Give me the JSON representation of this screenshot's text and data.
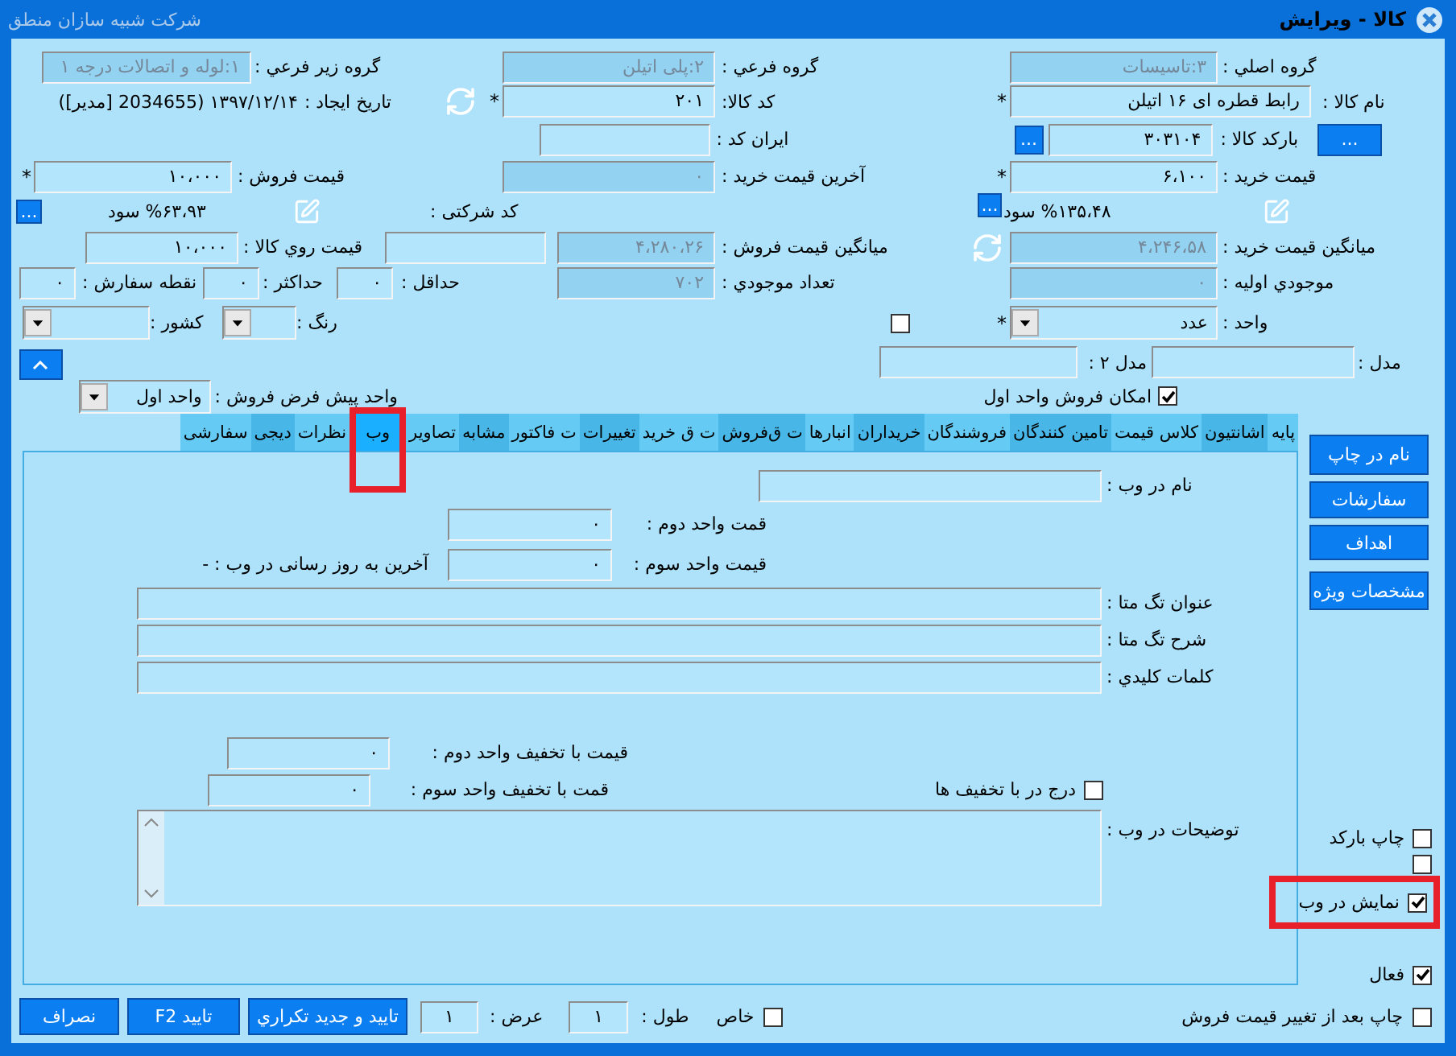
{
  "window": {
    "title": "کالا - ویرایش",
    "company": "شرکت شبیه سازان منطق"
  },
  "main_group": {
    "label": "گروه اصلي :",
    "value": "۳:تاسیسات",
    "disabled": true
  },
  "sub_group": {
    "label": "گروه فرعي :",
    "value": "۲:پلی اتیلن",
    "disabled": true
  },
  "sub_sub_group": {
    "label": "گروه زير فرعي :",
    "value": "۱:لوله  و اتصالات درجه ۱",
    "disabled": true
  },
  "item_name": {
    "label": "نام کالا :",
    "value": "رابط قطره ای ۱۶ اتیلن",
    "disabled": false,
    "mark": "*"
  },
  "item_code": {
    "label": "کد کالا:",
    "value": "۲۰۱",
    "disabled": false,
    "mark": "*"
  },
  "created": {
    "label": "تاریخ ایجاد :",
    "value": "۱۳۹۷/۱۲/۱۴ (2034655 [مدير])"
  },
  "barcode_button": "...",
  "barcode": {
    "label": "بارکد کالا :",
    "value": "۳۰۳۱۰۴",
    "disabled": false
  },
  "barcode_browse": "...",
  "iran_code": {
    "label": "ايران کد :",
    "disabled": false
  },
  "purchase_price": {
    "label": "قيمت خريد :",
    "value": "۶،۱۰۰",
    "disabled": false,
    "mark": "*"
  },
  "last_purchase_price": {
    "label": "آخرين قيمت خريد :",
    "value": "۰",
    "disabled": true
  },
  "sale_price": {
    "label": "قيمت فروش :",
    "value": "۱۰،۰۰۰",
    "disabled": false,
    "mark": "*"
  },
  "purchase_profit": "%۱۳۵،۴۸ سود",
  "purchase_browse": "...",
  "company_code": {
    "label": "کد شرکتی :",
    "disabled": false
  },
  "sale_profit": "%۶۳،۹۳ سود",
  "sale_browse": "...",
  "avg_purchase_price": {
    "label": "ميانگين قيمت خريد :",
    "value": "۴،۲۴۶،۵۸",
    "disabled": true
  },
  "avg_sale_price": {
    "label": "ميانگين قيمت فروش :",
    "value": "۴،۲۸۰،۲۶",
    "disabled": true
  },
  "label_price": {
    "label": "قيمت روي کالا :",
    "value": "۱۰،۰۰۰",
    "disabled": false
  },
  "initial_stock": {
    "label": "موجودي اوليه :",
    "value": "۰",
    "disabled": true
  },
  "stock_count": {
    "label": "تعداد موجودي :",
    "value": "۷۰۲",
    "disabled": true
  },
  "minimum": {
    "label": "حداقل :",
    "value": "۰",
    "disabled": false
  },
  "maximum": {
    "label": "حداکثر :",
    "value": "۰",
    "disabled": false
  },
  "reorder_point": {
    "label": "نقطه سفارش :",
    "value": "۰",
    "disabled": false
  },
  "unit": {
    "label": "واحد :",
    "value": "عدد",
    "mark": "*"
  },
  "unit_flag": {
    "checked": false
  },
  "color": {
    "label": "رنگ :"
  },
  "country": {
    "label": "کشور :"
  },
  "model": {
    "label": "مدل :",
    "disabled": false
  },
  "model_2": {
    "label": "مدل ۲ :",
    "disabled": false
  },
  "sell_first_unit": {
    "label": "امکان فروش واحد اول",
    "checked": true
  },
  "default_sale_unit": {
    "label": "واحد پيش فرض فروش :",
    "value": "واحد اول"
  },
  "tabs": [
    {
      "label": "پایه",
      "selected": false
    },
    {
      "label": "اشانتیون",
      "selected": false
    },
    {
      "label": "کلاس قیمت",
      "selected": false
    },
    {
      "label": "تامین کنندگان",
      "selected": false
    },
    {
      "label": "فروشندگان",
      "selected": false
    },
    {
      "label": "خریداران",
      "selected": false
    },
    {
      "label": "انبارها",
      "selected": false
    },
    {
      "label": "ت ق‌فروش",
      "selected": false
    },
    {
      "label": "ت ق خرید",
      "selected": false
    },
    {
      "label": "تغییرات",
      "selected": false
    },
    {
      "label": "ت فاکتور",
      "selected": false
    },
    {
      "label": "مشابه",
      "selected": false
    },
    {
      "label": "تصاویر",
      "selected": false
    },
    {
      "label": "وب",
      "selected": true
    },
    {
      "label": "نظرات",
      "selected": false
    },
    {
      "label": "دیجی",
      "selected": false
    },
    {
      "label": "سفارشی",
      "selected": false
    }
  ],
  "web": {
    "name": {
      "label": "نام در وب :"
    },
    "second_unit_price": {
      "label": "قمت واحد دوم :",
      "value": "۰"
    },
    "third_unit_price": {
      "label": "قيمت واحد سوم :",
      "value": "۰"
    },
    "last_update": "آخرين به روز رسانی در وب :  -",
    "meta_title": {
      "label": "عنوان تگ متا :"
    },
    "meta_description": {
      "label": "شرح تگ متا :"
    },
    "keywords": {
      "label": "کلمات کليدي :"
    },
    "second_discount_price": {
      "label": "قيمت با  تخفيف واحد دوم :",
      "value": "۰"
    },
    "include_discounts": {
      "label": "درج در با تخفيف ها",
      "checked": false
    },
    "third_discount_price": {
      "label": "قمت با  تخفيف واحد سوم :",
      "value": "۰"
    },
    "description": {
      "label": "توضيحات در وب :"
    }
  },
  "side_buttons": [
    "نام در چاپ",
    "سفارشات",
    "اهداف",
    "مشخصات ویژه"
  ],
  "side_checks": [
    {
      "label": "چاپ بارکد",
      "checked": false
    },
    {
      "checked": false
    },
    {
      "label": "نمایش در وب",
      "checked": true
    }
  ],
  "active": {
    "label": "فعال",
    "checked": true
  },
  "print_after_price_change": {
    "label": "چاپ بعد از تغيير قيمت فروش",
    "checked": false
  },
  "special": {
    "label": "خاص",
    "checked": false
  },
  "length": {
    "label": "طول :",
    "value": "۱"
  },
  "width": {
    "label": "عرض :",
    "value": "۱"
  },
  "footer_buttons": [
    "تاييد و جديد تکراري",
    "تاييد F2",
    "نصراف"
  ]
}
